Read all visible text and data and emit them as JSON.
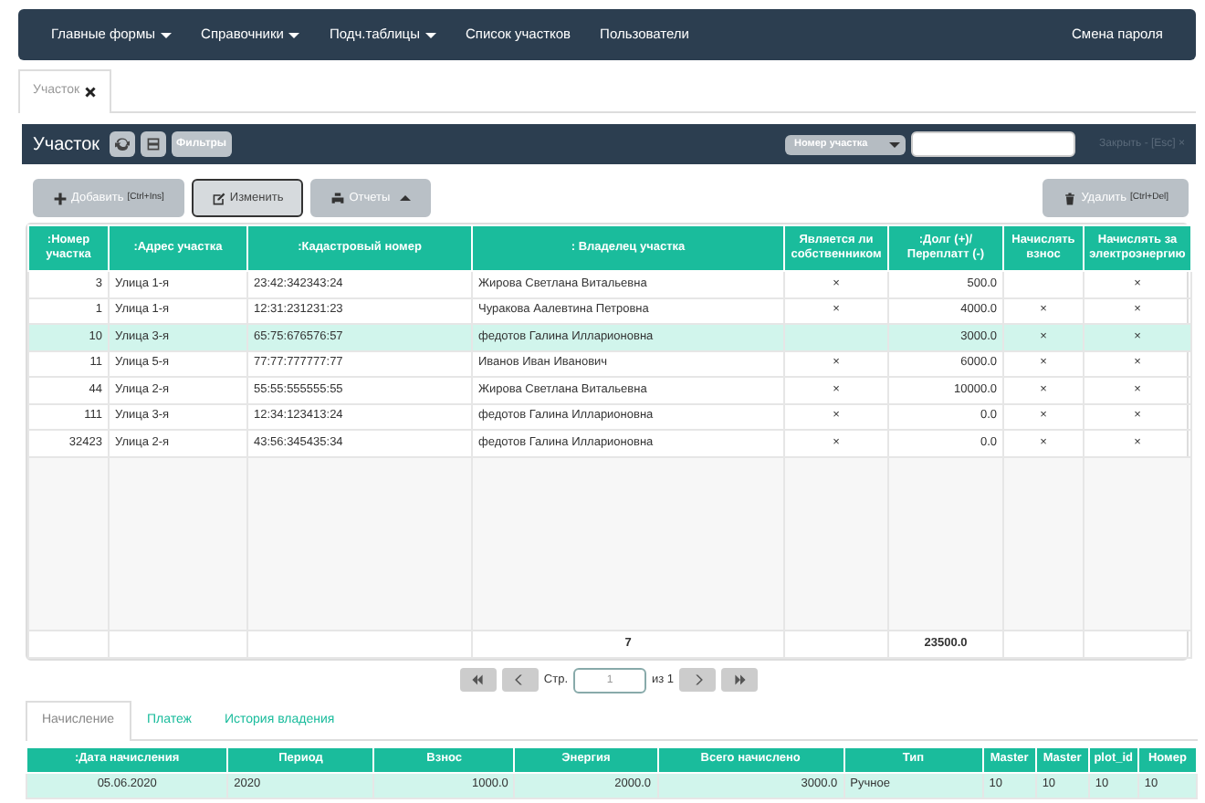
{
  "navbar": {
    "menus": [
      {
        "label": "Главные формы",
        "dropdown": true
      },
      {
        "label": "Справочники",
        "dropdown": true
      },
      {
        "label": "Подч.таблицы",
        "dropdown": true
      },
      {
        "label": "Список участков",
        "dropdown": false
      },
      {
        "label": "Пользователи",
        "dropdown": false
      }
    ],
    "right_link": "Смена пароля"
  },
  "doc_tabs": [
    {
      "label": "Участок",
      "selected": true
    }
  ],
  "panel": {
    "title": "Участок",
    "filter_button": "Фильтры",
    "search_select": "Номер участка",
    "close_link": "Закрыть - [Esc] ×"
  },
  "toolbar": [
    {
      "kind": "add",
      "label": "Добавить",
      "shortcut": "[Ctrl+Ins]",
      "focused": false,
      "dropdown": false
    },
    {
      "kind": "edit",
      "label": "Изменить",
      "focused": true,
      "dropdown": false
    },
    {
      "kind": "print",
      "label": "Отчеты",
      "focused": false,
      "dropdown": true
    },
    {
      "kind": "delete",
      "label": "Удалить",
      "shortcut": "[Ctrl+Del]",
      "focused": false,
      "dropdown": false
    }
  ],
  "table": {
    "columns": [
      ":Номер участка",
      ":Адрес участка",
      ":Кадастровый номер",
      ": Владелец участка",
      "Является ли собственником",
      ":Долг (+)/ Переплатт (-)",
      "Начислять взнос",
      "Начислять за электроэнергию"
    ],
    "rows": [
      {
        "number": "3",
        "address": "Улица 1-я",
        "cadastral": "23:42:342343:24",
        "owner": "Жирова Светлана Витальевна",
        "is_owner": true,
        "debt": "500.0",
        "charge_fee": false,
        "charge_energy": true,
        "selected": false
      },
      {
        "number": "1",
        "address": "Улица 1-я",
        "cadastral": "12:31:231231:23",
        "owner": "Чуракова Аалевтина Петровна",
        "is_owner": true,
        "debt": "4000.0",
        "charge_fee": true,
        "charge_energy": true,
        "selected": false
      },
      {
        "number": "10",
        "address": "Улица 3-я",
        "cadastral": "65:75:676576:57",
        "owner": "федотов Галина Илларионовна",
        "is_owner": false,
        "debt": "3000.0",
        "charge_fee": true,
        "charge_energy": true,
        "selected": true
      },
      {
        "number": "11",
        "address": "Улица 5-я",
        "cadastral": "77:77:777777:77",
        "owner": "Иванов Иван Иванович",
        "is_owner": true,
        "debt": "6000.0",
        "charge_fee": true,
        "charge_energy": true,
        "selected": false
      },
      {
        "number": "44",
        "address": "Улица 2-я",
        "cadastral": "55:55:555555:55",
        "owner": "Жирова Светлана Витальевна",
        "is_owner": true,
        "debt": "10000.0",
        "charge_fee": true,
        "charge_energy": true,
        "selected": false
      },
      {
        "number": "111",
        "address": "Улица 3-я",
        "cadastral": "12:34:123413:24",
        "owner": "федотов Галина Илларионовна",
        "is_owner": true,
        "debt": "0.0",
        "charge_fee": true,
        "charge_energy": true,
        "selected": false
      },
      {
        "number": "32423",
        "address": "Улица 2-я",
        "cadastral": "43:56:345435:34",
        "owner": "федотов Галина Илларионовна",
        "is_owner": true,
        "debt": "0.0",
        "charge_fee": true,
        "charge_energy": true,
        "selected": false
      }
    ],
    "mark": "×",
    "footer": {
      "count": "7",
      "total": "23500.0"
    }
  },
  "pager": {
    "label": "Стр.",
    "page": "1",
    "of": "из 1"
  },
  "detail_tabs": [
    {
      "label": "Начисление",
      "selected": true
    },
    {
      "label": "Платеж",
      "selected": false
    },
    {
      "label": "История владения",
      "selected": false
    }
  ],
  "detail_table": {
    "columns": [
      ":Дата начисления",
      "Период",
      "Взнос",
      "Энергия",
      "Всего начислено",
      "Тип",
      "Master",
      "Master",
      "plot_id",
      "Номер"
    ],
    "rows": [
      {
        "cells": [
          "05.06.2020",
          "2020",
          "1000.0",
          "2000.0",
          "3000.0",
          "Ручное",
          "10",
          "10",
          "10",
          "10"
        ],
        "selected": true
      }
    ]
  }
}
